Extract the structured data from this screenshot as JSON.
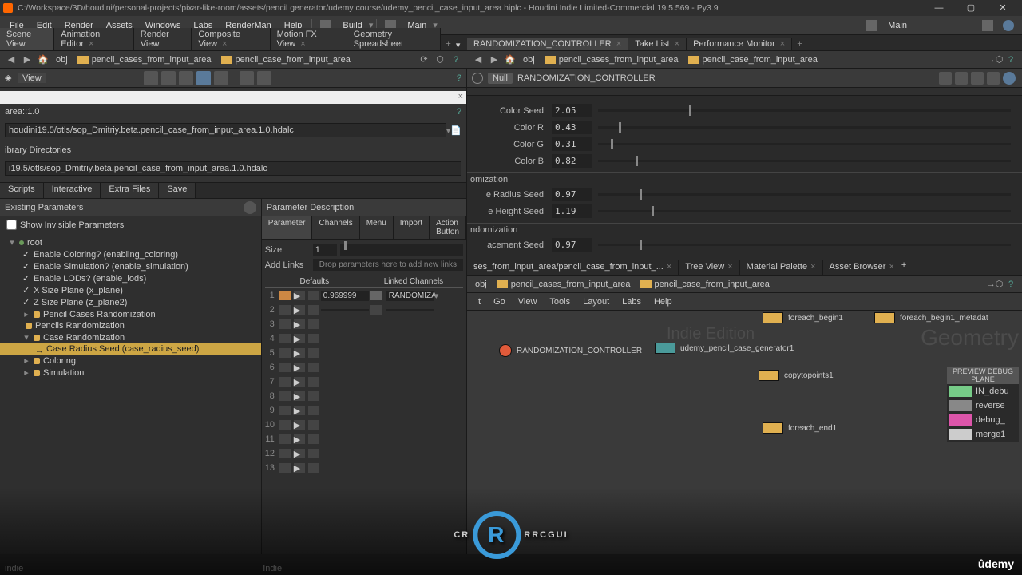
{
  "title_bar": {
    "title": "C:/Workspace/3D/houdini/personal-projects/pixar-like-room/assets/pencil generator/udemy course/udemy_pencil_case_input_area.hiplc - Houdini Indie Limited-Commercial 19.5.569 - Py3.9"
  },
  "menu": [
    "File",
    "Edit",
    "Render",
    "Assets",
    "Windows",
    "Labs",
    "RenderMan",
    "Help"
  ],
  "desktop": {
    "build": "Build",
    "main_l": "Main",
    "main_r": "Main"
  },
  "viewer_tabs": [
    {
      "label": "Scene View",
      "active": true
    },
    {
      "label": "Animation Editor"
    },
    {
      "label": "Render View"
    },
    {
      "label": "Composite View"
    },
    {
      "label": "Motion FX View"
    },
    {
      "label": "Geometry Spreadsheet"
    }
  ],
  "path_left": {
    "obj": "obj",
    "a": "pencil_cases_from_input_area",
    "b": "pencil_case_from_input_area"
  },
  "view_label": "View",
  "asset_dialog": {
    "hda_label": "area::1.0",
    "path1": "houdini19.5/otls/sop_Dmitriy.beta.pencil_case_from_input_area.1.0.hdalc",
    "lib_dirs": "ibrary Directories",
    "path2": "i19.5/otls/sop_Dmitriy.beta.pencil_case_from_input_area.1.0.hdalc"
  },
  "scripts_tabs": [
    "Scripts",
    "Interactive",
    "Extra Files",
    "Save"
  ],
  "existing_params": {
    "title": "Existing Parameters",
    "show_invisible": "Show Invisible Parameters",
    "root": "root",
    "items_check": [
      "Enable Coloring? (enabling_coloring)",
      "Enable Simulation? (enable_simulation)",
      "Enable LODs? (enable_lods)",
      "X Size Plane (x_plane)",
      "Z Size Plane (z_plane2)"
    ],
    "folders": [
      "Pencil Cases Randomization",
      "Pencils Randomization",
      "Case Randomization"
    ],
    "selected": "Case Radius Seed (case_radius_seed)",
    "tail": [
      "Coloring",
      "Simulation"
    ]
  },
  "param_desc": {
    "title": "Parameter Description",
    "tabs": [
      "Parameter",
      "Channels",
      "Menu",
      "Import",
      "Action Button"
    ],
    "size_label": "Size",
    "size_val": "1",
    "add_links_label": "Add Links",
    "add_links_drop": "Drop parameters here to add new links",
    "defaults": "Defaults",
    "linked": "Linked Channels",
    "row1_val": "0.969999",
    "row1_link": "RANDOMIZA"
  },
  "right_tabs": [
    {
      "label": "RANDOMIZATION_CONTROLLER",
      "active": true
    },
    {
      "label": "Take List"
    },
    {
      "label": "Performance Monitor"
    }
  ],
  "param_header": {
    "null": "Null",
    "name": "RANDOMIZATION_CONTROLLER"
  },
  "sliders": [
    {
      "label": "Color Seed",
      "val": "2.05",
      "pos": 22
    },
    {
      "label": "Color R",
      "val": "0.43",
      "pos": 5
    },
    {
      "label": "Color G",
      "val": "0.31",
      "pos": 3
    },
    {
      "label": "Color B",
      "val": "0.82",
      "pos": 9
    }
  ],
  "sec_a": "omization",
  "sliders_a": [
    {
      "label": "e Radius Seed",
      "val": "0.97",
      "pos": 10
    },
    {
      "label": "e Height Seed",
      "val": "1.19",
      "pos": 13
    }
  ],
  "sec_b": "ndomization",
  "sliders_b": [
    {
      "label": "acement Seed",
      "val": "0.97",
      "pos": 10
    }
  ],
  "net_tabs": [
    {
      "label": "ses_from_input_area/pencil_case_from_input_..."
    },
    {
      "label": "Tree View"
    },
    {
      "label": "Material Palette"
    },
    {
      "label": "Asset Browser"
    }
  ],
  "net_menu": [
    "t",
    "Go",
    "View",
    "Tools",
    "Layout",
    "Labs",
    "Help"
  ],
  "nodes": {
    "controller": "RANDOMIZATION_CONTROLLER",
    "udemy": "udemy_pencil_case_generator1",
    "copy": "copytopoints1",
    "fend": "foreach_end1",
    "fbegin": "foreach_begin1",
    "meta": "foreach_begin1_metadat"
  },
  "preview": {
    "title": "PREVIEW DEBUG PLANE",
    "rows": [
      "IN_debu",
      "reverse",
      "debug_",
      "merge1"
    ]
  },
  "watermarks": {
    "indie": "Indie Edition",
    "geom": "Geometry"
  },
  "footer": {
    "l": "indie",
    "c": "Indie"
  },
  "brand": {
    "udemy": "ûdemy"
  }
}
